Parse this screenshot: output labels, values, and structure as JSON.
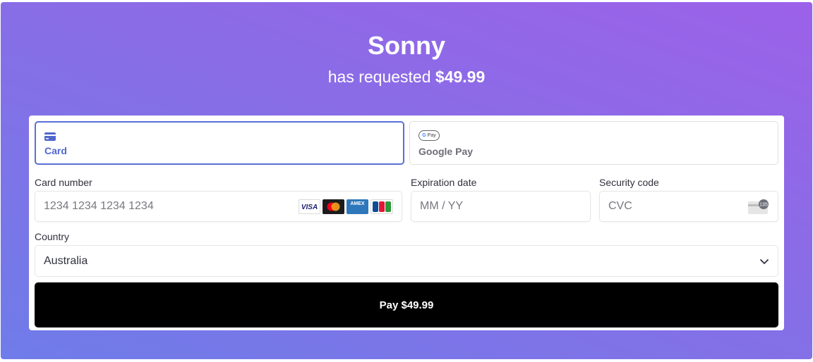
{
  "header": {
    "name": "Sonny",
    "request_prefix": "has requested",
    "amount": "$49.99"
  },
  "colors": {
    "gradient_start": "#9c61e9",
    "gradient_end": "#6f7ce9",
    "selected_tab": "#5167cf",
    "pay_button": "#000000"
  },
  "tabs": [
    {
      "label": "Card",
      "icon": "credit-card-icon",
      "selected": true
    },
    {
      "label": "Google Pay",
      "icon": "google-pay-icon",
      "badge": "Pay",
      "selected": false
    }
  ],
  "form": {
    "card_number": {
      "label": "Card number",
      "placeholder": "1234 1234 1234 1234",
      "value": ""
    },
    "card_brands": [
      "VISA",
      "Mastercard",
      "AMEX",
      "JCB"
    ],
    "expiration": {
      "label": "Expiration date",
      "placeholder": "MM / YY",
      "value": ""
    },
    "security": {
      "label": "Security code",
      "placeholder": "CVC",
      "value": "",
      "icon": "cvc-card-icon",
      "icon_text": "135"
    },
    "country": {
      "label": "Country",
      "value": "Australia"
    }
  },
  "pay_button": {
    "label": "Pay $49.99"
  }
}
